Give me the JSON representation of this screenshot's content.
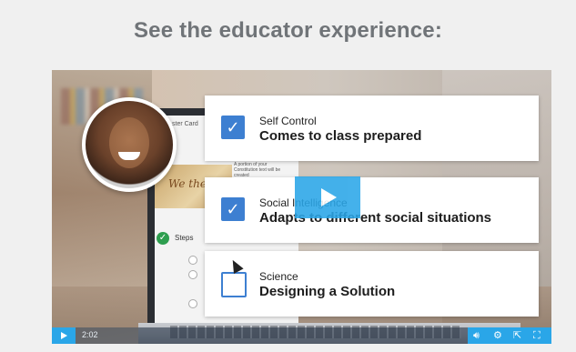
{
  "page": {
    "title": "See the educator experience:"
  },
  "video": {
    "screen": {
      "label_fragment": "ster Card",
      "document_text": "A portion of your Constitution text will be created",
      "steps_label": "Steps"
    },
    "cards": [
      {
        "category": "Self Control",
        "title": "Comes to class prepared",
        "checked": true
      },
      {
        "category": "Social Intelligence",
        "title": "Adapts to different social situations",
        "checked": true
      },
      {
        "category": "Science",
        "title": "Designing a Solution",
        "checked": false
      }
    ],
    "controls": {
      "time": "2:02",
      "icons": [
        "volume-icon",
        "settings-gear-icon",
        "share-icon",
        "fullscreen-icon"
      ]
    }
  },
  "colors": {
    "accent": "#2aa6e8",
    "checkbox": "#3d7fd1",
    "title": "#707478"
  }
}
